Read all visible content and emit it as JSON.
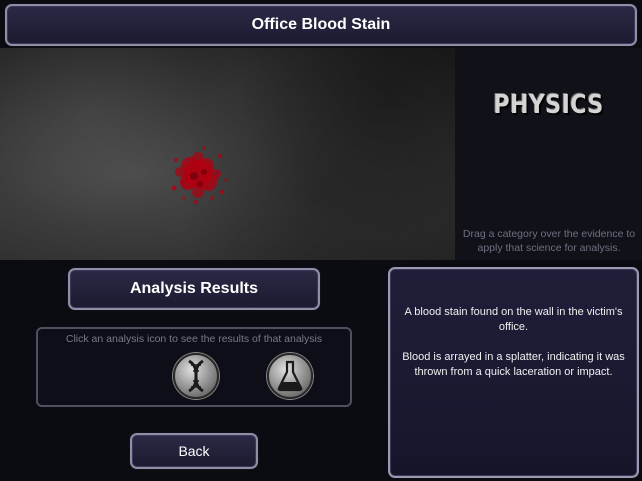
{
  "title": "Office Blood Stain",
  "science_category": "PHYSICS",
  "drag_hint": "Drag a category over the evidence to apply that science for analysis.",
  "analysis": {
    "header": "Analysis Results",
    "hint": "Click an analysis icon to see the results of that analysis",
    "icons": [
      "dna-icon",
      "flask-icon"
    ]
  },
  "back_label": "Back",
  "description": {
    "line1": "A blood stain found on the wall in the victim's office.",
    "line2": "Blood is arrayed in a splatter, indicating it was thrown from a quick laceration or impact."
  },
  "colors": {
    "panel": "#1f1f3a",
    "border": "#8e8ea6",
    "blood": "#b00010"
  }
}
